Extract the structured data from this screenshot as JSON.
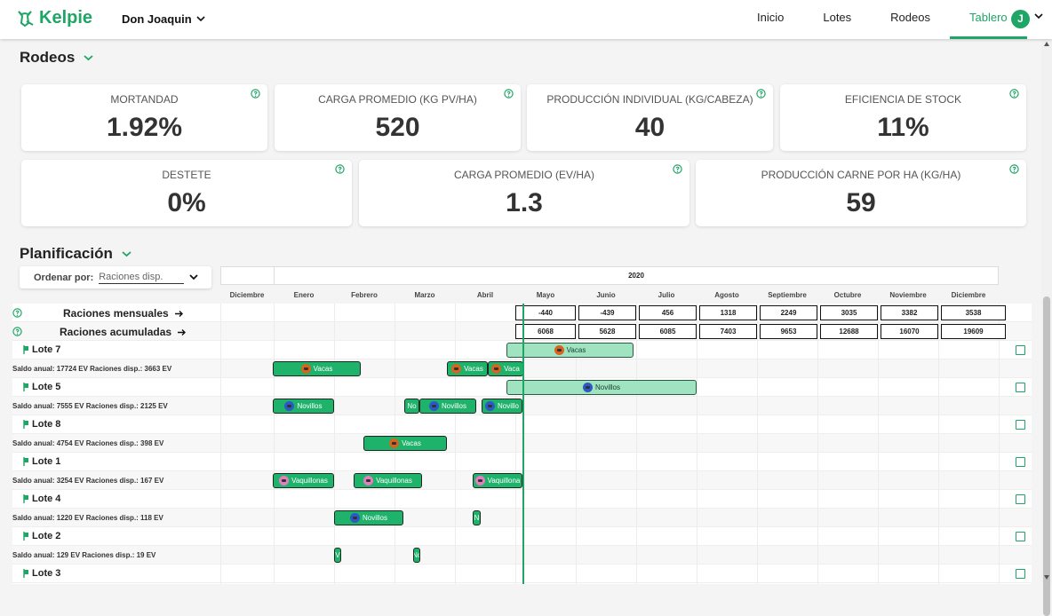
{
  "brand": {
    "name": "Kelpie",
    "color": "#1fa565"
  },
  "header": {
    "establishment": "Don Joaquin",
    "nav": [
      "Inicio",
      "Lotes",
      "Rodeos",
      "Tablero"
    ],
    "active_nav": "Tablero",
    "avatar_letter": "J"
  },
  "rodeos": {
    "title": "Rodeos",
    "kpis_row1": [
      {
        "label": "Mortandad",
        "value": "1.92%"
      },
      {
        "label": "Carga promedio (kg PV/ha)",
        "value": "520"
      },
      {
        "label": "Producción individual (kg/cabeza)",
        "value": "40"
      },
      {
        "label": "Eficiencia de stock",
        "value": "11%"
      }
    ],
    "kpis_row2": [
      {
        "label": "Destete",
        "value": "0%"
      },
      {
        "label": "Carga promedio (EV/ha)",
        "value": "1.3"
      },
      {
        "label": "Producción carne por ha (kg/ha)",
        "value": "59"
      }
    ]
  },
  "planificacion": {
    "title": "Planificación",
    "sort_label": "Ordenar por:",
    "sort_value": "Raciones disp.",
    "year": "2020",
    "months": [
      "Diciembre",
      "Enero",
      "Febrero",
      "Marzo",
      "Abril",
      "Mayo",
      "Junio",
      "Julio",
      "Agosto",
      "Septiembre",
      "Octubre",
      "Noviembre",
      "Diciembre"
    ],
    "raciones_mensuales": {
      "label": "Raciones mensuales",
      "values": [
        "-440",
        "-439",
        "456",
        "1318",
        "2249",
        "3035",
        "3382",
        "3538"
      ]
    },
    "raciones_acumuladas": {
      "label": "Raciones acumuladas",
      "values": [
        "6068",
        "5628",
        "6085",
        "7403",
        "9653",
        "12688",
        "16070",
        "19609"
      ]
    },
    "lotes": [
      {
        "name": "Lote 7",
        "saldo": "Saldo anual: 17724 EV  Raciones disp.: 3663 EV"
      },
      {
        "name": "Lote 5",
        "saldo": "Saldo anual: 7555 EV  Raciones disp.: 2125 EV"
      },
      {
        "name": "Lote 8",
        "saldo": "Saldo anual: 4754 EV  Raciones disp.: 398 EV"
      },
      {
        "name": "Lote 1",
        "saldo": "Saldo anual: 3254 EV  Raciones disp.: 167 EV"
      },
      {
        "name": "Lote 4",
        "saldo": "Saldo anual: 1220 EV  Raciones disp.: 118 EV"
      },
      {
        "name": "Lote 2",
        "saldo": "Saldo anual: 129 EV  Raciones disp.: 19 EV"
      },
      {
        "name": "Lote 3",
        "saldo": ""
      }
    ],
    "bar_labels": {
      "vacas": "Vacas",
      "vaca_short": "Vaca",
      "novillos": "Novillos",
      "novillo_short": "Novillo",
      "no_short": "No",
      "vaquillonas": "Vaquillonas",
      "vaquillonas_short": "Vaquillona",
      "n": "N",
      "v": "V",
      "nc": "Nc"
    }
  },
  "icons": {
    "help": "help-circle-icon",
    "chevron": "chevron-down-icon",
    "arrow": "arrow-right-icon",
    "flag": "flag-icon"
  }
}
